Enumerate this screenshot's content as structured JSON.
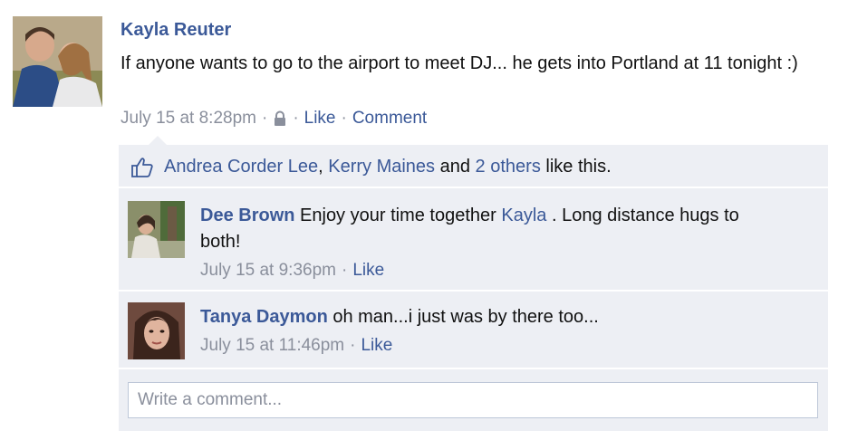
{
  "post": {
    "author": "Kayla Reuter",
    "text": "If anyone wants to go to the airport to meet DJ... he gets into Portland at 11 tonight :)",
    "timestamp": "July 15 at 8:28pm",
    "privacy_icon": "lock-icon",
    "like_label": "Like",
    "comment_label": "Comment",
    "separator": "·"
  },
  "likes": {
    "icon": "thumbs-up-icon",
    "person1": "Andrea Corder Lee",
    "comma": ",",
    "person2": "Kerry Maines",
    "and_text": "and",
    "others": "2 others",
    "suffix": "like this."
  },
  "comments": [
    {
      "author": "Dee Brown",
      "text_before": "Enjoy your time together",
      "mention": "Kayla",
      "text_after": ". Long distance hugs to both!",
      "timestamp": "July 15 at 9:36pm",
      "like_label": "Like"
    },
    {
      "author": "Tanya Daymon",
      "text": "oh man...i just was by there too...",
      "timestamp": "July 15 at 11:46pm",
      "like_label": "Like"
    }
  ],
  "composer": {
    "placeholder": "Write a comment..."
  },
  "colors": {
    "link": "#3b5998",
    "meta": "#8a8f9c",
    "ufi_bg": "#edeff4"
  }
}
